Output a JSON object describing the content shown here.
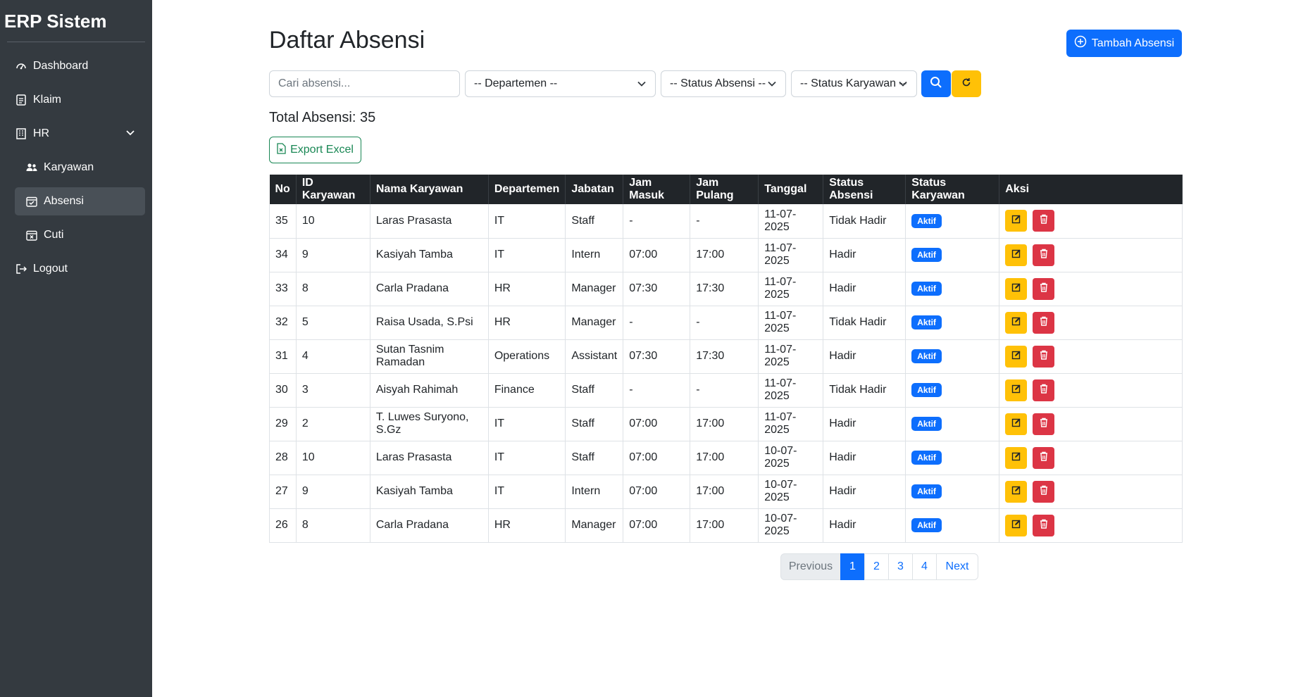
{
  "sidebar": {
    "brand": "ERP Sistem",
    "items": [
      {
        "label": "Dashboard",
        "icon": "speedometer-icon"
      },
      {
        "label": "Klaim",
        "icon": "document-icon"
      },
      {
        "label": "HR",
        "icon": "building-icon"
      },
      {
        "label": "Karyawan",
        "icon": "people-icon"
      },
      {
        "label": "Absensi",
        "icon": "calendar-check-icon"
      },
      {
        "label": "Cuti",
        "icon": "calendar-x-icon"
      },
      {
        "label": "Logout",
        "icon": "logout-icon"
      }
    ]
  },
  "header": {
    "title": "Daftar Absensi",
    "add_label": "Tambah Absensi"
  },
  "filters": {
    "search_placeholder": "Cari absensi...",
    "departemen": "-- Departemen --",
    "status_absensi": "-- Status Absensi --",
    "status_karyawan": "-- Status Karyawan --"
  },
  "summary": {
    "total_label": "Total Absensi: 35",
    "export_label": "Export Excel"
  },
  "table": {
    "headers": [
      "No",
      "ID Karyawan",
      "Nama Karyawan",
      "Departemen",
      "Jabatan",
      "Jam Masuk",
      "Jam Pulang",
      "Tanggal",
      "Status Absensi",
      "Status Karyawan",
      "Aksi"
    ],
    "rows": [
      {
        "no": "35",
        "id": "10",
        "nama": "Laras Prasasta",
        "dept": "IT",
        "jabatan": "Staff",
        "masuk": "-",
        "pulang": "-",
        "tanggal": "11-07-2025",
        "status": "Tidak Hadir",
        "karyawan": "Aktif"
      },
      {
        "no": "34",
        "id": "9",
        "nama": "Kasiyah Tamba",
        "dept": "IT",
        "jabatan": "Intern",
        "masuk": "07:00",
        "pulang": "17:00",
        "tanggal": "11-07-2025",
        "status": "Hadir",
        "karyawan": "Aktif"
      },
      {
        "no": "33",
        "id": "8",
        "nama": "Carla Pradana",
        "dept": "HR",
        "jabatan": "Manager",
        "masuk": "07:30",
        "pulang": "17:30",
        "tanggal": "11-07-2025",
        "status": "Hadir",
        "karyawan": "Aktif"
      },
      {
        "no": "32",
        "id": "5",
        "nama": "Raisa Usada, S.Psi",
        "dept": "HR",
        "jabatan": "Manager",
        "masuk": "-",
        "pulang": "-",
        "tanggal": "11-07-2025",
        "status": "Tidak Hadir",
        "karyawan": "Aktif"
      },
      {
        "no": "31",
        "id": "4",
        "nama": "Sutan Tasnim Ramadan",
        "dept": "Operations",
        "jabatan": "Assistant",
        "masuk": "07:30",
        "pulang": "17:30",
        "tanggal": "11-07-2025",
        "status": "Hadir",
        "karyawan": "Aktif"
      },
      {
        "no": "30",
        "id": "3",
        "nama": "Aisyah Rahimah",
        "dept": "Finance",
        "jabatan": "Staff",
        "masuk": "-",
        "pulang": "-",
        "tanggal": "11-07-2025",
        "status": "Tidak Hadir",
        "karyawan": "Aktif"
      },
      {
        "no": "29",
        "id": "2",
        "nama": "T. Luwes Suryono, S.Gz",
        "dept": "IT",
        "jabatan": "Staff",
        "masuk": "07:00",
        "pulang": "17:00",
        "tanggal": "11-07-2025",
        "status": "Hadir",
        "karyawan": "Aktif"
      },
      {
        "no": "28",
        "id": "10",
        "nama": "Laras Prasasta",
        "dept": "IT",
        "jabatan": "Staff",
        "masuk": "07:00",
        "pulang": "17:00",
        "tanggal": "10-07-2025",
        "status": "Hadir",
        "karyawan": "Aktif"
      },
      {
        "no": "27",
        "id": "9",
        "nama": "Kasiyah Tamba",
        "dept": "IT",
        "jabatan": "Intern",
        "masuk": "07:00",
        "pulang": "17:00",
        "tanggal": "10-07-2025",
        "status": "Hadir",
        "karyawan": "Aktif"
      },
      {
        "no": "26",
        "id": "8",
        "nama": "Carla Pradana",
        "dept": "HR",
        "jabatan": "Manager",
        "masuk": "07:00",
        "pulang": "17:00",
        "tanggal": "10-07-2025",
        "status": "Hadir",
        "karyawan": "Aktif"
      }
    ]
  },
  "pagination": {
    "prev": "Previous",
    "pages": [
      "1",
      "2",
      "3",
      "4"
    ],
    "next": "Next",
    "active_page": "1"
  },
  "colors": {
    "primary": "#0d6efd",
    "warning": "#ffc107",
    "danger": "#dc3545",
    "success": "#198754",
    "sidebar": "#343a40"
  }
}
